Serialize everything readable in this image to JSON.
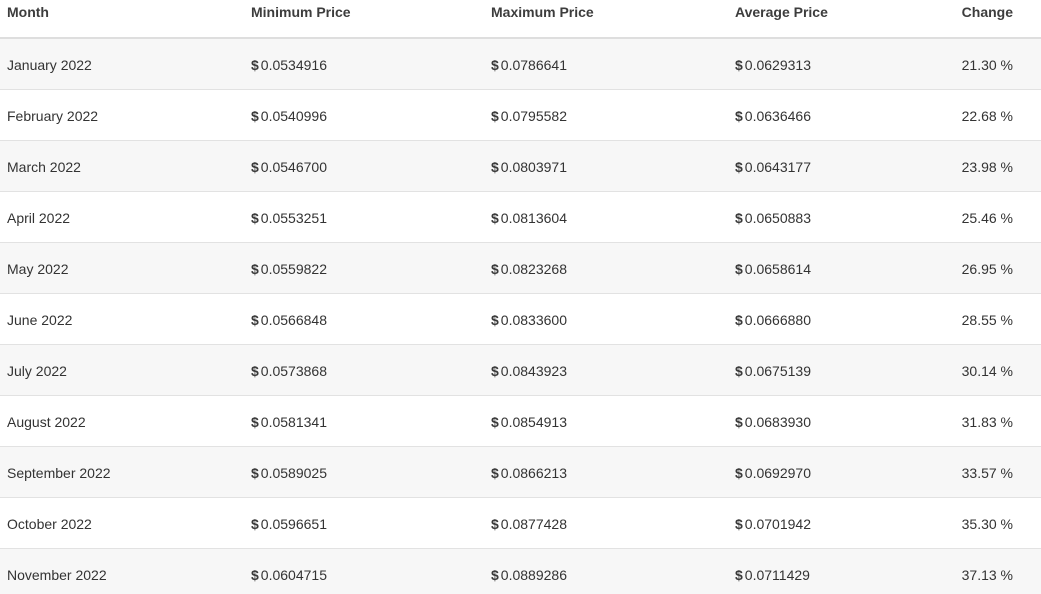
{
  "table": {
    "headers": {
      "month": "Month",
      "min": "Minimum Price",
      "max": "Maximum Price",
      "avg": "Average Price",
      "change": "Change"
    },
    "currency_symbol": "$",
    "rows": [
      {
        "month": "January 2022",
        "min": "0.0534916",
        "max": "0.0786641",
        "avg": "0.0629313",
        "change": "21.30 %"
      },
      {
        "month": "February 2022",
        "min": "0.0540996",
        "max": "0.0795582",
        "avg": "0.0636466",
        "change": "22.68 %"
      },
      {
        "month": "March 2022",
        "min": "0.0546700",
        "max": "0.0803971",
        "avg": "0.0643177",
        "change": "23.98 %"
      },
      {
        "month": "April 2022",
        "min": "0.0553251",
        "max": "0.0813604",
        "avg": "0.0650883",
        "change": "25.46 %"
      },
      {
        "month": "May 2022",
        "min": "0.0559822",
        "max": "0.0823268",
        "avg": "0.0658614",
        "change": "26.95 %"
      },
      {
        "month": "June 2022",
        "min": "0.0566848",
        "max": "0.0833600",
        "avg": "0.0666880",
        "change": "28.55 %"
      },
      {
        "month": "July 2022",
        "min": "0.0573868",
        "max": "0.0843923",
        "avg": "0.0675139",
        "change": "30.14 %"
      },
      {
        "month": "August 2022",
        "min": "0.0581341",
        "max": "0.0854913",
        "avg": "0.0683930",
        "change": "31.83 %"
      },
      {
        "month": "September 2022",
        "min": "0.0589025",
        "max": "0.0866213",
        "avg": "0.0692970",
        "change": "33.57 %"
      },
      {
        "month": "October 2022",
        "min": "0.0596651",
        "max": "0.0877428",
        "avg": "0.0701942",
        "change": "35.30 %"
      },
      {
        "month": "November 2022",
        "min": "0.0604715",
        "max": "0.0889286",
        "avg": "0.0711429",
        "change": "37.13 %"
      }
    ]
  }
}
